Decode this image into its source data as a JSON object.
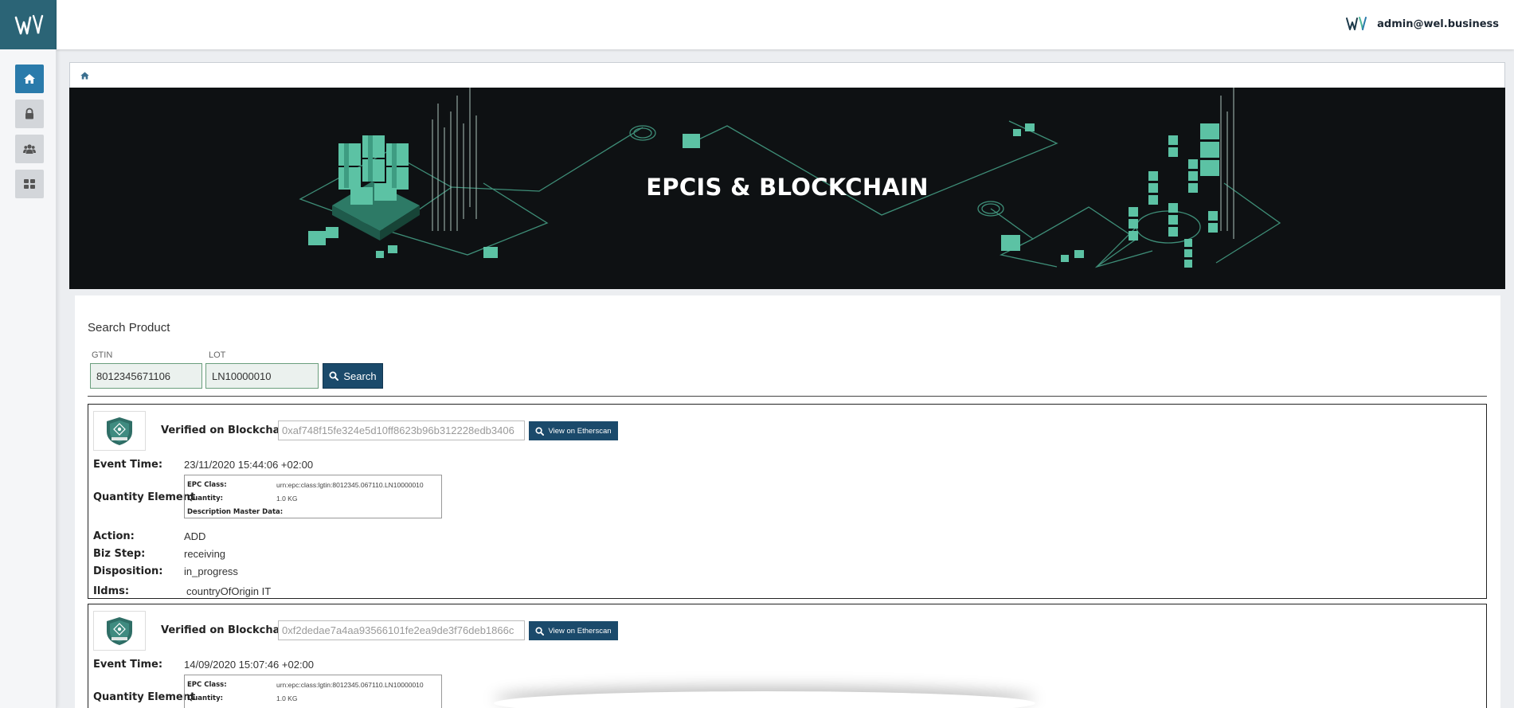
{
  "user": {
    "email": "admin@wel.business"
  },
  "banner": {
    "title": "EPCIS & BLOCKCHAIN"
  },
  "search": {
    "title": "Search Product",
    "gtin_label": "GTIN",
    "gtin_value": "8012345671106",
    "lot_label": "LOT",
    "lot_value": "LN10000010",
    "button_label": "Search"
  },
  "labels": {
    "verified": "Verified on Blockchain:",
    "etherscan": "View on Etherscan",
    "event_time": "Event Time:",
    "quantity_element": "Quantity Element",
    "epc_class": "EPC Class:",
    "quantity": "Quantity:",
    "description": "Description Master Data:",
    "action": "Action:",
    "biz_step": "Biz Step:",
    "disposition": "Disposition:",
    "ildms": "Ildms:"
  },
  "events": [
    {
      "hash": "0xaf748f15fe324e5d10ff8623b96b312228edb3406",
      "event_time": "23/11/2020 15:44:06 +02:00",
      "epc_class": "urn:epc:class:lgtin:8012345.067110.LN10000010",
      "quantity": "1.0 KG",
      "description": "",
      "action": "ADD",
      "biz_step": "receiving",
      "disposition": "in_progress",
      "ildms": "countryOfOrigin IT"
    },
    {
      "hash": "0xf2dedae7a4aa93566101fe2ea9de3f76deb1866c",
      "event_time": "14/09/2020 15:07:46 +02:00",
      "epc_class": "urn:epc:class:lgtin:8012345.067110.LN10000010",
      "quantity": "1.0 KG"
    }
  ],
  "colors": {
    "sidebar_logo": "#2b6476",
    "accent": "#2a7bab",
    "button": "#1b4a6b",
    "banner_bg": "#0e1113",
    "teal": "#4fb89a"
  }
}
